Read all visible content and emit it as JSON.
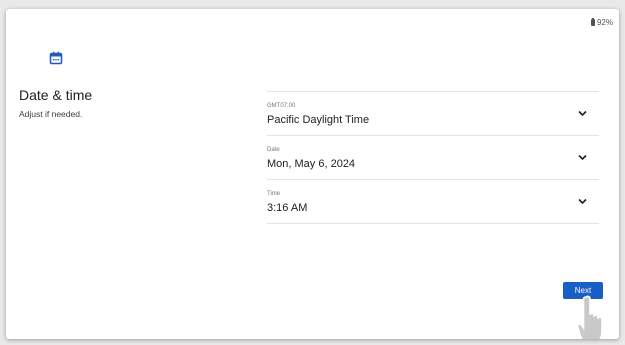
{
  "status": {
    "battery_label": "92%"
  },
  "header": {
    "title": "Date & time",
    "subtitle": "Adjust if needed."
  },
  "fields": {
    "timezone": {
      "caption": "GMT07:00",
      "value": "Pacific Daylight Time"
    },
    "date": {
      "caption": "Date",
      "value": "Mon, May 6, 2024"
    },
    "time": {
      "caption": "Time",
      "value": "3:16 AM"
    }
  },
  "actions": {
    "next_label": "Next"
  },
  "colors": {
    "accent": "#1a5fc6",
    "icon_blue": "#1f5fbf"
  },
  "icons": {
    "header": "calendar-icon",
    "dropdown": "chevron-down-icon",
    "overlay": "hand-pointer-icon",
    "status": "battery-icon"
  }
}
